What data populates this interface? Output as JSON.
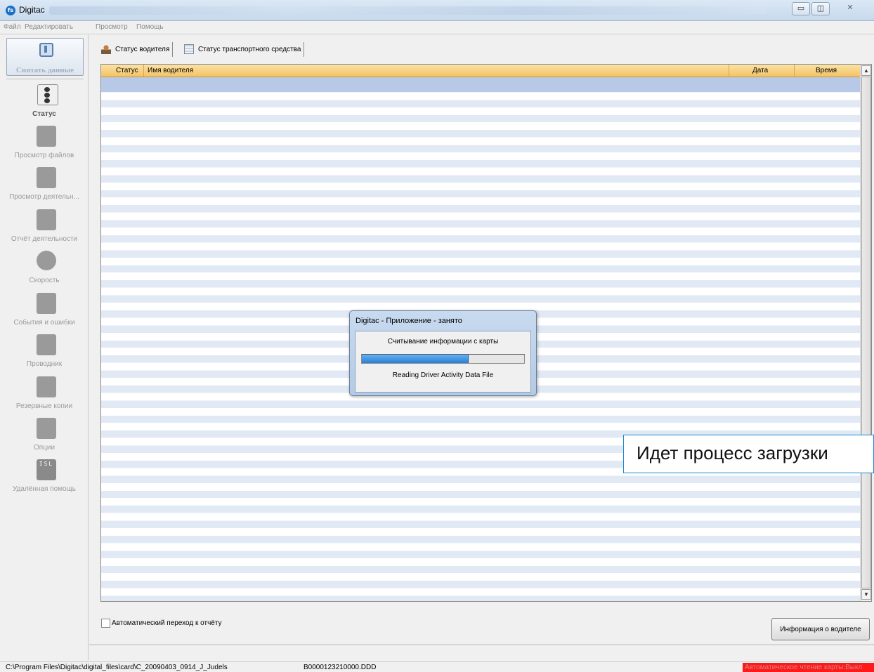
{
  "window": {
    "title": "Digitac",
    "icon": "fs-logo-icon",
    "controls": [
      "minimize",
      "maximize",
      "close"
    ]
  },
  "menu": [
    "Файл",
    "Редактировать",
    "Просмотр",
    "Помощь"
  ],
  "sidebar": {
    "capture_label": "Снятать данные",
    "items": [
      {
        "label": "Статус",
        "icon": "status-icon",
        "active": true
      },
      {
        "label": "Просмотр файлов",
        "icon": "files-icon"
      },
      {
        "label": "Просмотр деятельн...",
        "icon": "activity-icon"
      },
      {
        "label": "Отчёт деятельности",
        "icon": "report-icon"
      },
      {
        "label": "Скорость",
        "icon": "speed-icon"
      },
      {
        "label": "События и ошибки",
        "icon": "events-icon"
      },
      {
        "label": "Проводник",
        "icon": "explorer-icon"
      },
      {
        "label": "Резервные копии",
        "icon": "backup-icon"
      },
      {
        "label": "Опции",
        "icon": "options-icon"
      },
      {
        "label": "Удалённая помощь",
        "icon": "isl-icon",
        "icon_text": "ISL"
      }
    ]
  },
  "tabs": [
    {
      "label": "Статус водителя",
      "active": true
    },
    {
      "label": "Статус транспортного средства"
    }
  ],
  "table": {
    "columns": [
      "Статус",
      "Имя водителя",
      "Дата",
      "Время"
    ]
  },
  "auto_report": {
    "label": "Автоматический переход к отчёту",
    "checked": false
  },
  "info_button": "Информация о водителе",
  "status_bar": {
    "path": "C:\\Program Files\\Digitac\\digital_files\\card\\C_20090403_0914_J_Judels",
    "file": "B0000123210000.DDD",
    "auto_read": "Автоматическое чтение карты:Выкл",
    "auto_read_color": "#ff1a1a"
  },
  "dialog": {
    "title": "Digitac - Приложение - занято",
    "message": "Считывание информации с карты",
    "progress": 0.66,
    "sub_message": "Reading Driver Activity Data File"
  },
  "callout": {
    "text": "Идет процесс загрузки",
    "border_color": "#1b88d4"
  }
}
